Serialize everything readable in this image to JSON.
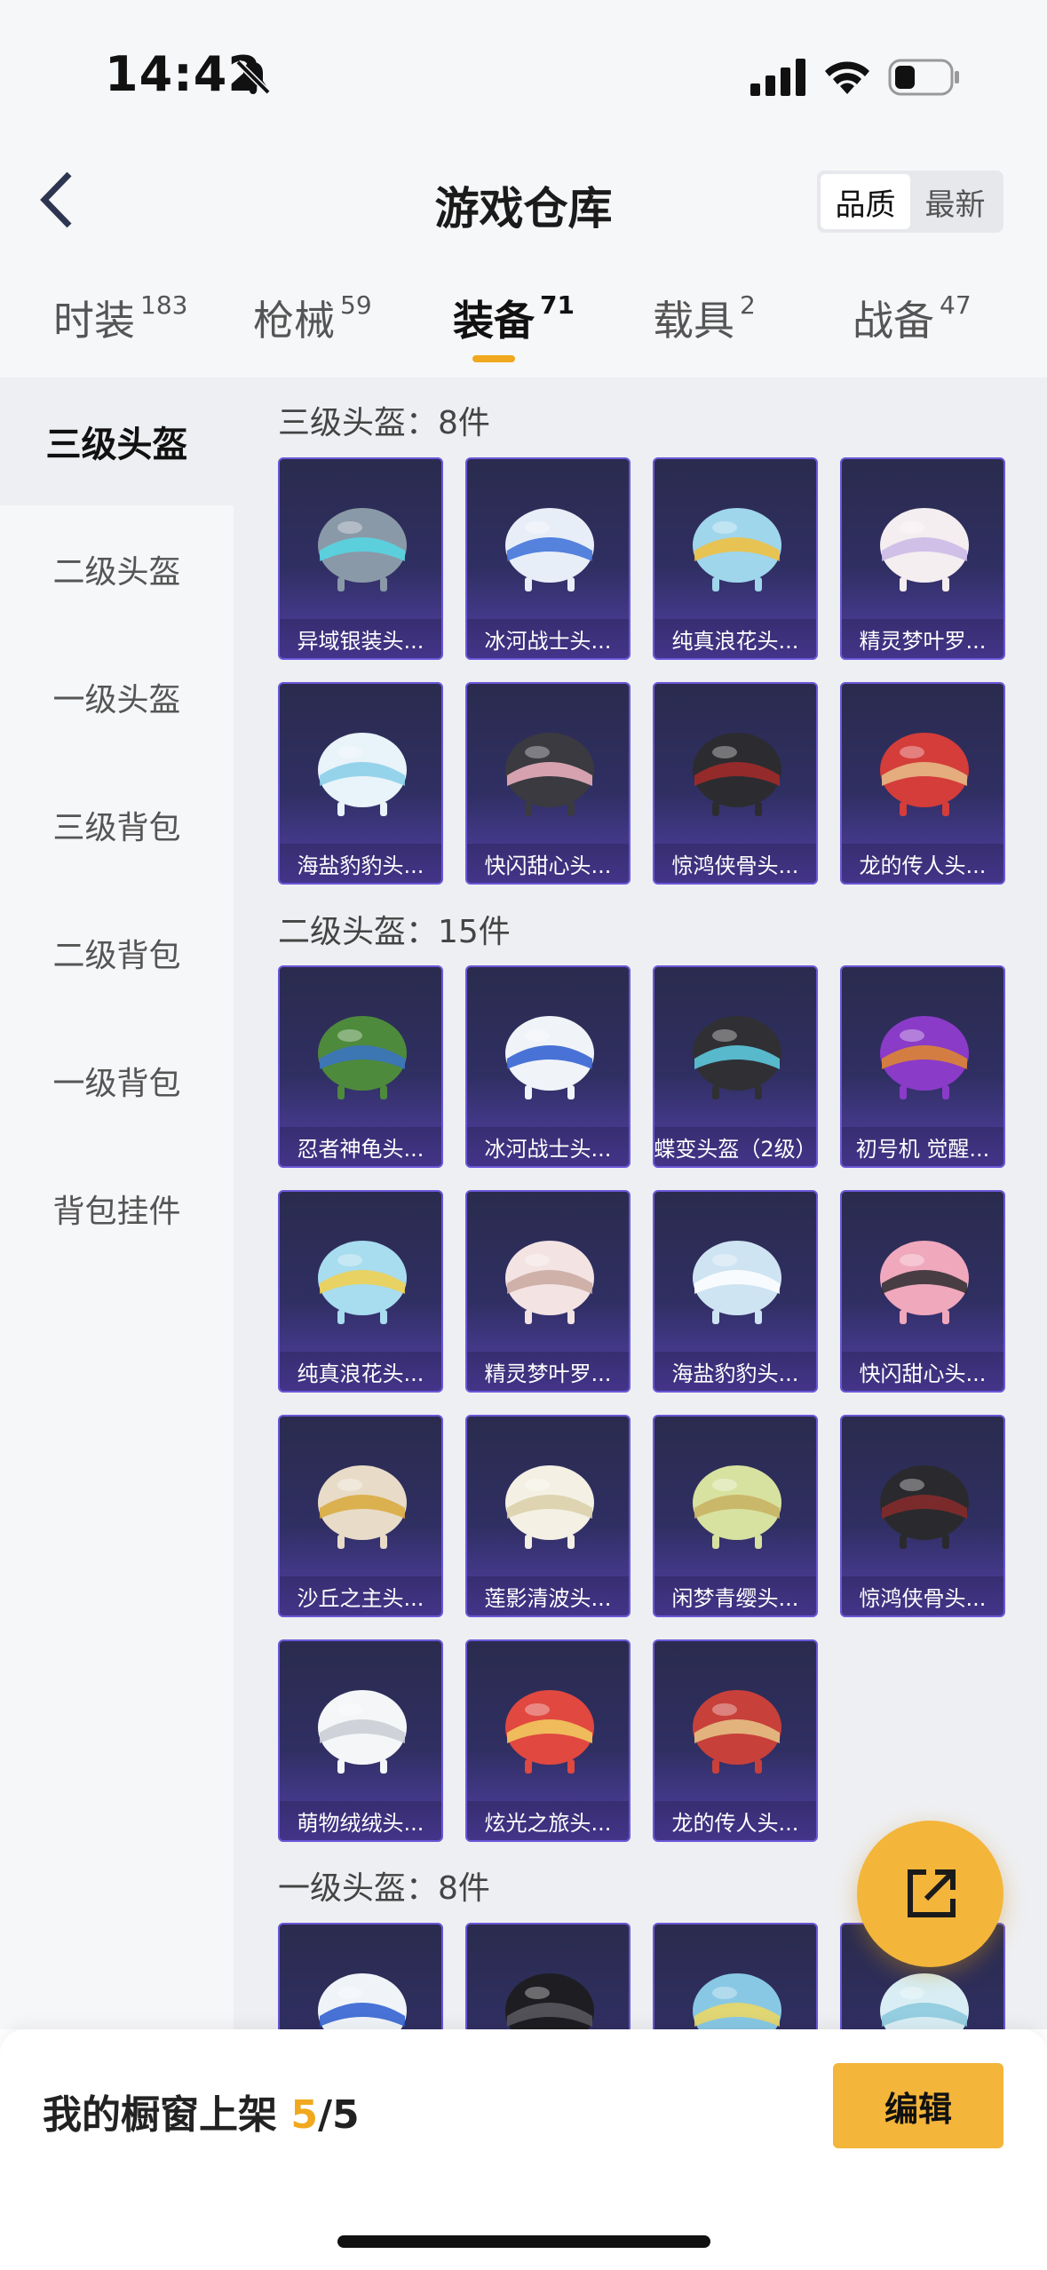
{
  "status": {
    "time": "14:42"
  },
  "header": {
    "title": "游戏仓库",
    "sort": [
      "品质",
      "最新"
    ]
  },
  "tabs": [
    {
      "label": "时装",
      "count": "183"
    },
    {
      "label": "枪械",
      "count": "59"
    },
    {
      "label": "装备",
      "count": "71"
    },
    {
      "label": "载具",
      "count": "2"
    },
    {
      "label": "战备",
      "count": "47"
    }
  ],
  "sidebar": [
    "三级头盔",
    "二级头盔",
    "一级头盔",
    "三级背包",
    "二级背包",
    "一级背包",
    "背包挂件"
  ],
  "sections": [
    {
      "title": "三级头盔：8件"
    },
    {
      "title": "二级头盔：15件"
    },
    {
      "title": "一级头盔：8件"
    }
  ],
  "items": [
    {
      "label": "异域银装头...",
      "color": "#8a99a8",
      "accent": "#54d8e6"
    },
    {
      "label": "冰河战士头...",
      "color": "#e8eef8",
      "accent": "#3a6fd8"
    },
    {
      "label": "纯真浪花头...",
      "color": "#9fd6ec",
      "accent": "#f3c03a"
    },
    {
      "label": "精灵梦叶罗...",
      "color": "#f4eef0",
      "accent": "#c9b7e6"
    },
    {
      "label": "海盐豹豹头...",
      "color": "#e8f3fa",
      "accent": "#86cde8"
    },
    {
      "label": "快闪甜心头...",
      "color": "#3a3a40",
      "accent": "#f2b5c4"
    },
    {
      "label": "惊鸿侠骨头...",
      "color": "#2c2c30",
      "accent": "#a82a2a"
    },
    {
      "label": "龙的传人头...",
      "color": "#d43d3a",
      "accent": "#e8c08a"
    },
    {
      "label": "忍者神龟头...",
      "color": "#4e8a3c",
      "accent": "#3a72c8"
    },
    {
      "label": "冰河战士头...",
      "color": "#f0f3f8",
      "accent": "#2a5ad0"
    },
    {
      "label": "蝶变头盔（2级）",
      "color": "#303034",
      "accent": "#5fd0e8"
    },
    {
      "label": "初号机 觉醒...",
      "color": "#8a3bc8",
      "accent": "#e08a2a"
    },
    {
      "label": "纯真浪花头...",
      "color": "#a8dcef",
      "accent": "#f2d04a"
    },
    {
      "label": "精灵梦叶罗...",
      "color": "#f3e3e3",
      "accent": "#c8a8a0"
    },
    {
      "label": "海盐豹豹头...",
      "color": "#cfe4f2",
      "accent": "#ffffff"
    },
    {
      "label": "快闪甜心头...",
      "color": "#f0a8bc",
      "accent": "#2a2a2e"
    },
    {
      "label": "沙丘之主头...",
      "color": "#e8dcc8",
      "accent": "#d8a83a"
    },
    {
      "label": "莲影清波头...",
      "color": "#f4f0e4",
      "accent": "#d9cfa8"
    },
    {
      "label": "闲梦青缨头...",
      "color": "#d8e2a0",
      "accent": "#c8b060"
    },
    {
      "label": "惊鸿侠骨头...",
      "color": "#2a2a2e",
      "accent": "#8a2a2a"
    },
    {
      "label": "萌物绒绒头...",
      "color": "#f4f6f8",
      "accent": "#c8ccd4"
    },
    {
      "label": "炫光之旅头...",
      "color": "#e04840",
      "accent": "#f2d060"
    },
    {
      "label": "龙的传人头...",
      "color": "#c8403a",
      "accent": "#e8c88a"
    },
    {
      "label": "",
      "color": "#f0f4f8",
      "accent": "#2a5ad0"
    },
    {
      "label": "",
      "color": "#1e1e22",
      "accent": "#5a5a60"
    },
    {
      "label": "",
      "color": "#88c8e4",
      "accent": "#f0d860"
    },
    {
      "label": "",
      "color": "#d8eef4",
      "accent": "#8ac8dc"
    }
  ],
  "showcase": {
    "label": "我的橱窗上架",
    "current": "5",
    "total": "/5"
  },
  "edit_label": "编辑"
}
